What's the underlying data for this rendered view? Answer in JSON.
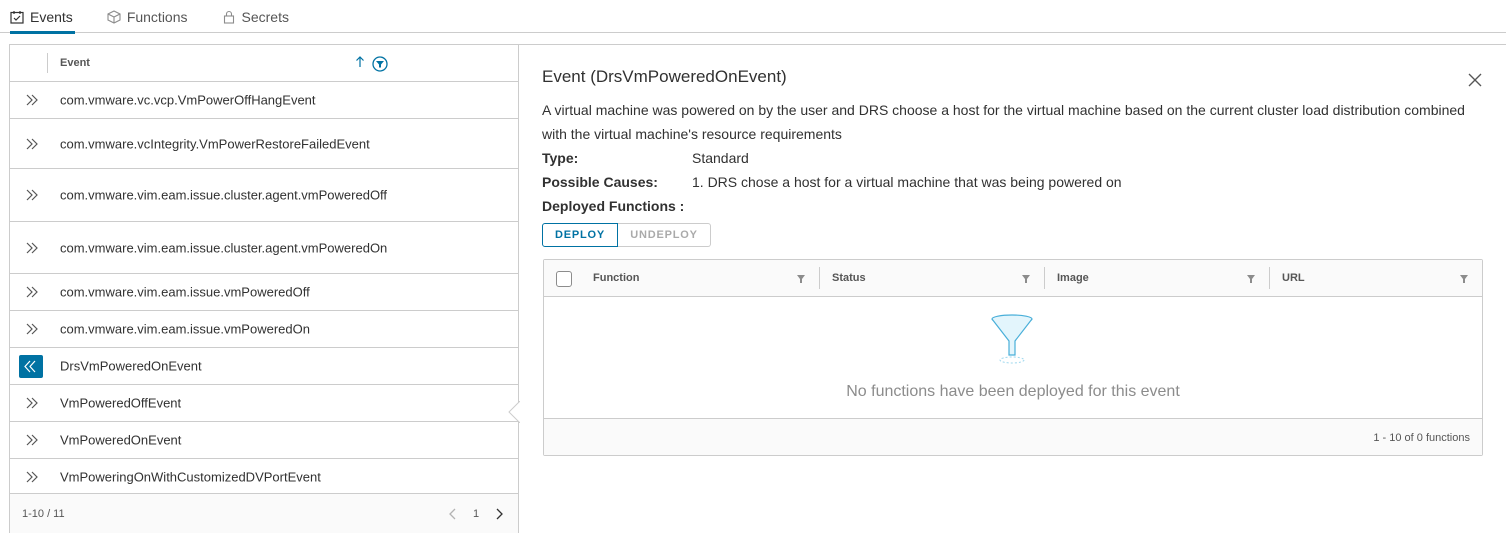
{
  "tabs": [
    {
      "label": "Events",
      "icon": "calendar-check-icon",
      "active": true
    },
    {
      "label": "Functions",
      "icon": "cube-icon",
      "active": false
    },
    {
      "label": "Secrets",
      "icon": "lock-icon",
      "active": false
    }
  ],
  "list": {
    "header": "Event",
    "rows": [
      "com.vmware.vc.vcp.VmPowerOffHangEvent",
      "com.vmware.vcIntegrity.VmPowerRestoreFailedEvent",
      "com.vmware.vim.eam.issue.cluster.agent.vmPoweredOff",
      "com.vmware.vim.eam.issue.cluster.agent.vmPoweredOn",
      "com.vmware.vim.eam.issue.vmPoweredOff",
      "com.vmware.vim.eam.issue.vmPoweredOn",
      "DrsVmPoweredOnEvent",
      "VmPoweredOffEvent",
      "VmPoweredOnEvent",
      "VmPoweringOnWithCustomizedDVPortEvent"
    ],
    "selected_index": 6,
    "footer": {
      "range": "1-10 / 11",
      "page": "1"
    }
  },
  "detail": {
    "title": "Event (DrsVmPoweredOnEvent)",
    "description": "A virtual machine was powered on by the user and DRS choose a host for the virtual machine based on the current cluster load distribution combined with the virtual machine's resource requirements",
    "type_label": "Type:",
    "type_value": "Standard",
    "causes_label": "Possible Causes:",
    "causes_value": "1. DRS chose a host for a virtual machine that was being powered on",
    "deployed_label": "Deployed Functions :",
    "deploy_button": "DEPLOY",
    "undeploy_button": "UNDEPLOY",
    "grid": {
      "columns": [
        "Function",
        "Status",
        "Image",
        "URL"
      ],
      "empty_message": "No functions have been deployed for this event",
      "footer": "1 - 10 of 0 functions"
    }
  },
  "colors": {
    "accent": "#0072a3",
    "border": "#cccccc"
  }
}
